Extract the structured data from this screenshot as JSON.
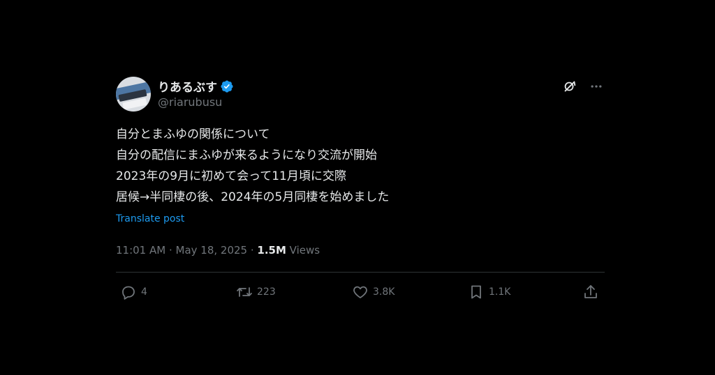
{
  "author": {
    "display_name": "りあるぶす",
    "handle": "@riarubusu",
    "verified": true
  },
  "post": {
    "lines": [
      "自分とまふゆの関係について",
      "自分の配信にまふゆが来るようになり交流が開始",
      "2023年の9月に初めて会って11月頃に交際",
      "居候→半同棲の後、2024年の5月同棲を始めました"
    ],
    "translate_label": "Translate post"
  },
  "meta": {
    "time": "11:01 AM",
    "separator1": " · ",
    "date": "May 18, 2025",
    "separator2": " · ",
    "views_count": "1.5M",
    "views_label": " Views"
  },
  "actions": {
    "replies": "4",
    "reposts": "223",
    "likes": "3.8K",
    "bookmarks": "1.1K"
  },
  "colors": {
    "background": "#000000",
    "text": "#e7e9ea",
    "secondary": "#71767b",
    "accent": "#1d9bf0",
    "divider": "#2f3336"
  },
  "icons": {
    "verified": "verified-badge-icon",
    "grok": "grok-icon",
    "more": "more-icon",
    "reply": "reply-icon",
    "repost": "repost-icon",
    "like": "like-icon",
    "bookmark": "bookmark-icon",
    "share": "share-icon"
  }
}
